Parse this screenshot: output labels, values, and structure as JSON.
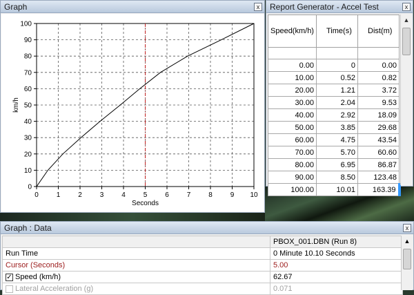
{
  "graph_window": {
    "title": "Graph",
    "close": "x"
  },
  "report_window": {
    "title": "Report Generator - Accel Test",
    "close": "x",
    "columns": [
      "Speed(km/h)",
      "Time(s)",
      "Dist(m)"
    ],
    "rows": [
      [
        "0.00",
        "0",
        "0.00"
      ],
      [
        "10.00",
        "0.52",
        "0.82"
      ],
      [
        "20.00",
        "1.21",
        "3.72"
      ],
      [
        "30.00",
        "2.04",
        "9.53"
      ],
      [
        "40.00",
        "2.92",
        "18.09"
      ],
      [
        "50.00",
        "3.85",
        "29.68"
      ],
      [
        "60.00",
        "4.75",
        "43.54"
      ],
      [
        "70.00",
        "5.70",
        "60.60"
      ],
      [
        "80.00",
        "6.95",
        "86.87"
      ],
      [
        "90.00",
        "8.50",
        "123.48"
      ],
      [
        "100.00",
        "10.01",
        "163.39"
      ]
    ]
  },
  "data_window": {
    "title": "Graph : Data",
    "close": "x",
    "file_header": "PBOX_001.DBN (Run 8)",
    "rows": [
      {
        "label": "Run Time",
        "value": "0 Minute 10.10 Seconds"
      },
      {
        "label": "Cursor (Seconds)",
        "value": "5.00"
      },
      {
        "label": "Speed (km/h)",
        "value": "62.67",
        "checked": "✓"
      },
      {
        "label": "Lateral Acceleration (g)",
        "value": "0.071"
      }
    ]
  },
  "chart_data": {
    "type": "line",
    "xlabel": "Seconds",
    "ylabel": "km/h",
    "xlim": [
      0,
      10
    ],
    "ylim": [
      0,
      100
    ],
    "xticks": [
      "0",
      "1",
      "2",
      "3",
      "4",
      "5",
      "6",
      "7",
      "8",
      "9",
      "10"
    ],
    "yticks": [
      "0",
      "10",
      "20",
      "30",
      "40",
      "50",
      "60",
      "70",
      "80",
      "90",
      "100"
    ],
    "grid": true,
    "cursor_x": 5,
    "line_color": "#000000",
    "cursor_color": "#c02020",
    "series": [
      {
        "x": [
          0,
          0.52,
          1.21,
          2.04,
          2.92,
          3.85,
          4.75,
          5.7,
          6.95,
          8.5,
          10.01
        ],
        "y": [
          0,
          10,
          20,
          30,
          40,
          50,
          60,
          70,
          80,
          90,
          100
        ]
      }
    ]
  }
}
